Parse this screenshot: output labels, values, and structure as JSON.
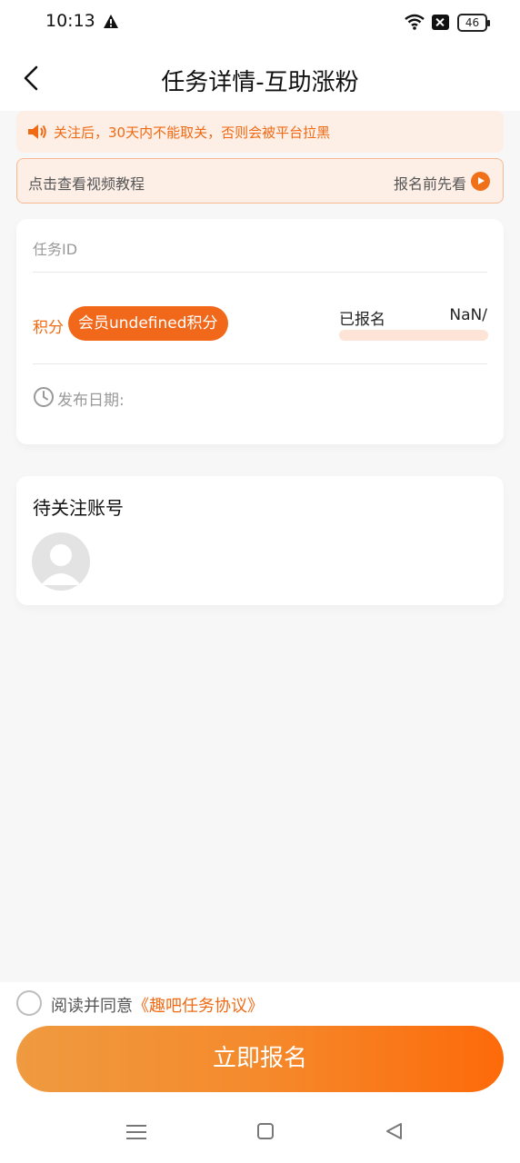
{
  "status_bar": {
    "time": "10:13",
    "battery": "46",
    "icons": [
      "alert-icon",
      "wifi-icon",
      "sim-off-icon",
      "battery-icon"
    ]
  },
  "nav": {
    "title": "任务详情-互助涨粉",
    "back_icon": "chevron-left-icon"
  },
  "notice": {
    "text": "关注后，30天内不能取关，否则会被平台拉黑",
    "icon": "speaker-icon"
  },
  "video": {
    "left_label": "点击查看视频教程",
    "right_label": "报名前先看",
    "icon": "play-icon"
  },
  "task": {
    "id_label": "任务ID",
    "points_label": "积分",
    "points_badge": "会员undefined积分",
    "signed_label": "已报名",
    "signed_count": "NaN/",
    "signed_progress": 0,
    "publish_label": "发布日期:"
  },
  "accounts": {
    "title": "待关注账号",
    "avatar_icon": "default-avatar-icon"
  },
  "agreement": {
    "prefix": "阅读并同意",
    "link": "《趣吧任务协议》"
  },
  "submit": {
    "label": "立即报名"
  },
  "colors": {
    "accent": "#f06a13",
    "notice_bg": "#fdeee6",
    "page_bg": "#f7f7f7"
  }
}
